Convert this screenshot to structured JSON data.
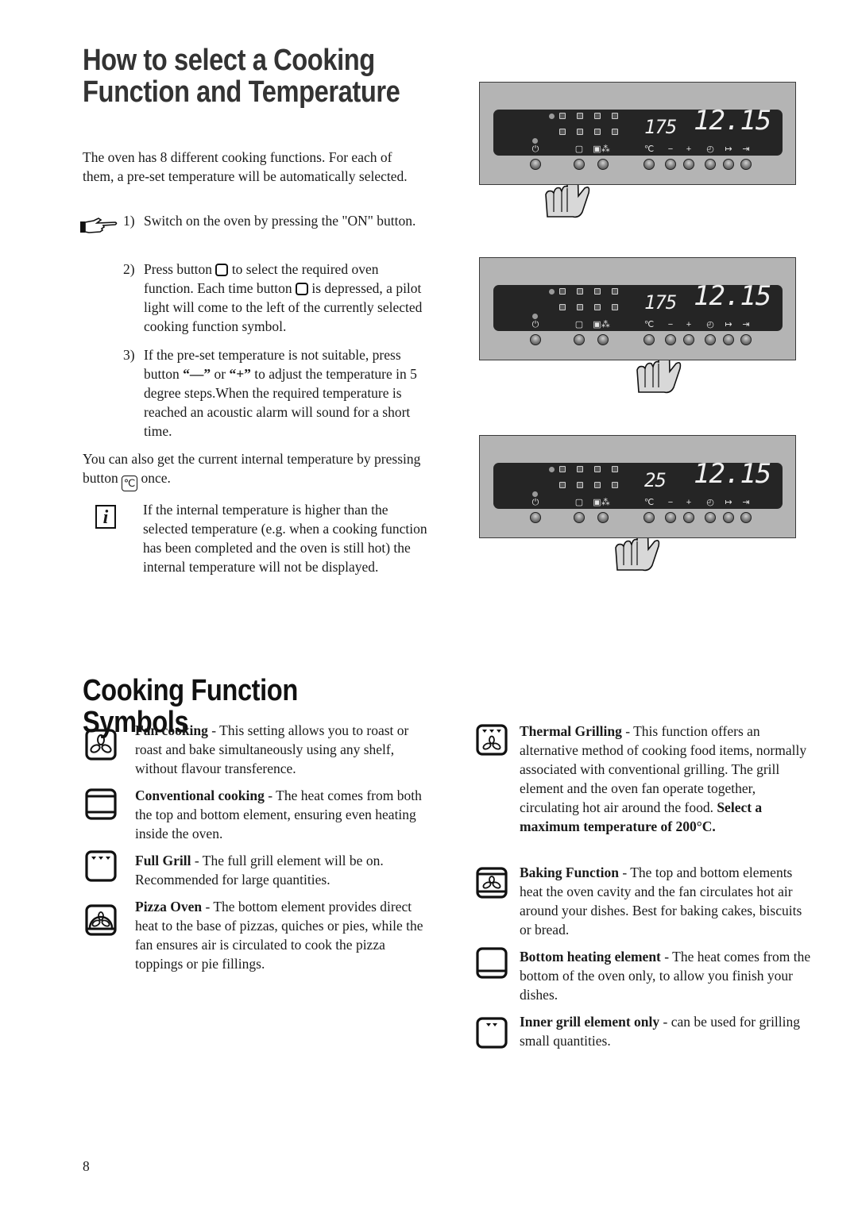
{
  "section1": {
    "title_line1": "How to select a Cooking",
    "title_line2": "Function and Temperature",
    "intro": "The oven has 8 different cooking functions. For each of them, a pre-set temperature will be automatically selected.",
    "steps": [
      {
        "num": "1)",
        "text": "Switch on the oven by pressing the \"ON\" button."
      },
      {
        "num": "2)",
        "text_a": "Press button",
        "text_b": "to select the required oven function. Each time button",
        "text_c": "is depressed, a pilot light will come to the left of the currently selected cooking function symbol."
      },
      {
        "num": "3)",
        "text_a": "If the pre-set temperature is not suitable, press button",
        "minus_label": "“—”",
        "or": "or",
        "plus_label": "“+”",
        "text_b": "to adjust the temperature in 5 degree steps.When the required temperature is reached an acoustic alarm will sound for a short time."
      }
    ],
    "internal_temp_a": "You can also get the current internal temperature by pressing button",
    "internal_temp_button": "℃",
    "internal_temp_b": "once.",
    "info_note": "If the internal temperature is higher than the selected temperature (e.g. when a cooking function has been completed and the oven is still hot) the internal temperature will not be displayed.",
    "info_icon": "i"
  },
  "panels": [
    {
      "temp": "175",
      "clock": "12.15",
      "pressed": "function-button"
    },
    {
      "temp": "175",
      "clock": "12.15",
      "pressed": "minus-button"
    },
    {
      "temp": "25",
      "clock": "12.15",
      "pressed": "temperature-button"
    }
  ],
  "panel_labels": {
    "on": "⏻",
    "function": "▢",
    "temp": "℃",
    "minus": "−",
    "plus": "+",
    "clock": "◴",
    "duration": "↦",
    "end": "⇥"
  },
  "section2": {
    "title": "Cooking Function Symbols",
    "symbols_left": [
      {
        "icon": "fan-cooking-icon",
        "name": "Fan cooking",
        "desc": " - This setting allows you to roast or roast and bake simultaneously using any shelf, without flavour transference."
      },
      {
        "icon": "conventional-cooking-icon",
        "name": "Conventional cooking",
        "desc": " - The heat comes from both the top and bottom element, ensuring even heating inside the oven."
      },
      {
        "icon": "full-grill-icon",
        "name": "Full Grill",
        "desc": " - The full grill element will be on. Recommended for large quantities."
      },
      {
        "icon": "pizza-oven-icon",
        "name": "Pizza Oven",
        "desc": " - The bottom element provides direct heat to the base of pizzas, quiches or pies, while the fan ensures air is circulated to cook the pizza toppings or pie fillings."
      }
    ],
    "symbols_right": [
      {
        "icon": "thermal-grilling-icon",
        "name": "Thermal Grilling",
        "desc": " - This function offers an alternative method of cooking food items, normally associated with conventional grilling. The grill element and the oven fan operate together, circulating hot air around the food. ",
        "warning": "Select a maximum temperature of 200°C."
      },
      {
        "icon": "baking-function-icon",
        "name": "Baking Function",
        "desc": " - The top and bottom elements heat the oven cavity and the fan circulates hot air around your dishes. Best for baking cakes, biscuits or bread."
      },
      {
        "icon": "bottom-heating-icon",
        "name": "Bottom heating element",
        "desc": " - The heat comes from the bottom of the oven only, to allow you finish your dishes."
      },
      {
        "icon": "inner-grill-icon",
        "name": "Inner grill element only",
        "desc": " - can be used for grilling small quantities."
      }
    ]
  },
  "page_number": "8"
}
